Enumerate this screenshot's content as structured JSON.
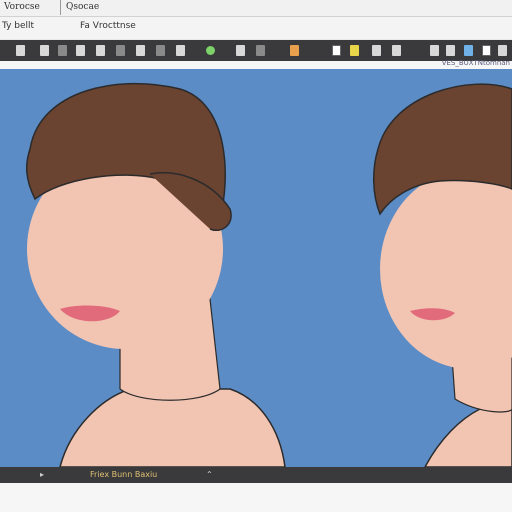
{
  "window": {
    "tabs": [
      "Vorocse",
      "Qsocae"
    ]
  },
  "menubar": {
    "items": [
      "Ty bellt",
      "Fa Vrocttnse"
    ]
  },
  "toolbar": {
    "icons": [
      "file-icon",
      "folder-icon",
      "save-icon",
      "undo-icon",
      "redo-icon",
      "brush-icon",
      "pen-icon",
      "eraser-icon",
      "select-icon",
      "move-icon",
      "zoom-icon",
      "color-icon",
      "layer-icon",
      "fill-icon",
      "text-icon",
      "shape-icon",
      "crop-icon",
      "settings-icon"
    ]
  },
  "subbar": {
    "text": "VES_BUXTNtomnan"
  },
  "canvas": {
    "background": "#5b8cc6",
    "skin": "#f2c4b2",
    "hair": "#6b4331",
    "lips": "#e26b7b"
  },
  "bottombar": {
    "text": "Friex Bunn Baxiu"
  },
  "colors": {
    "toolbar": "#3a3a3d",
    "chrome": "#f4f4f5"
  }
}
